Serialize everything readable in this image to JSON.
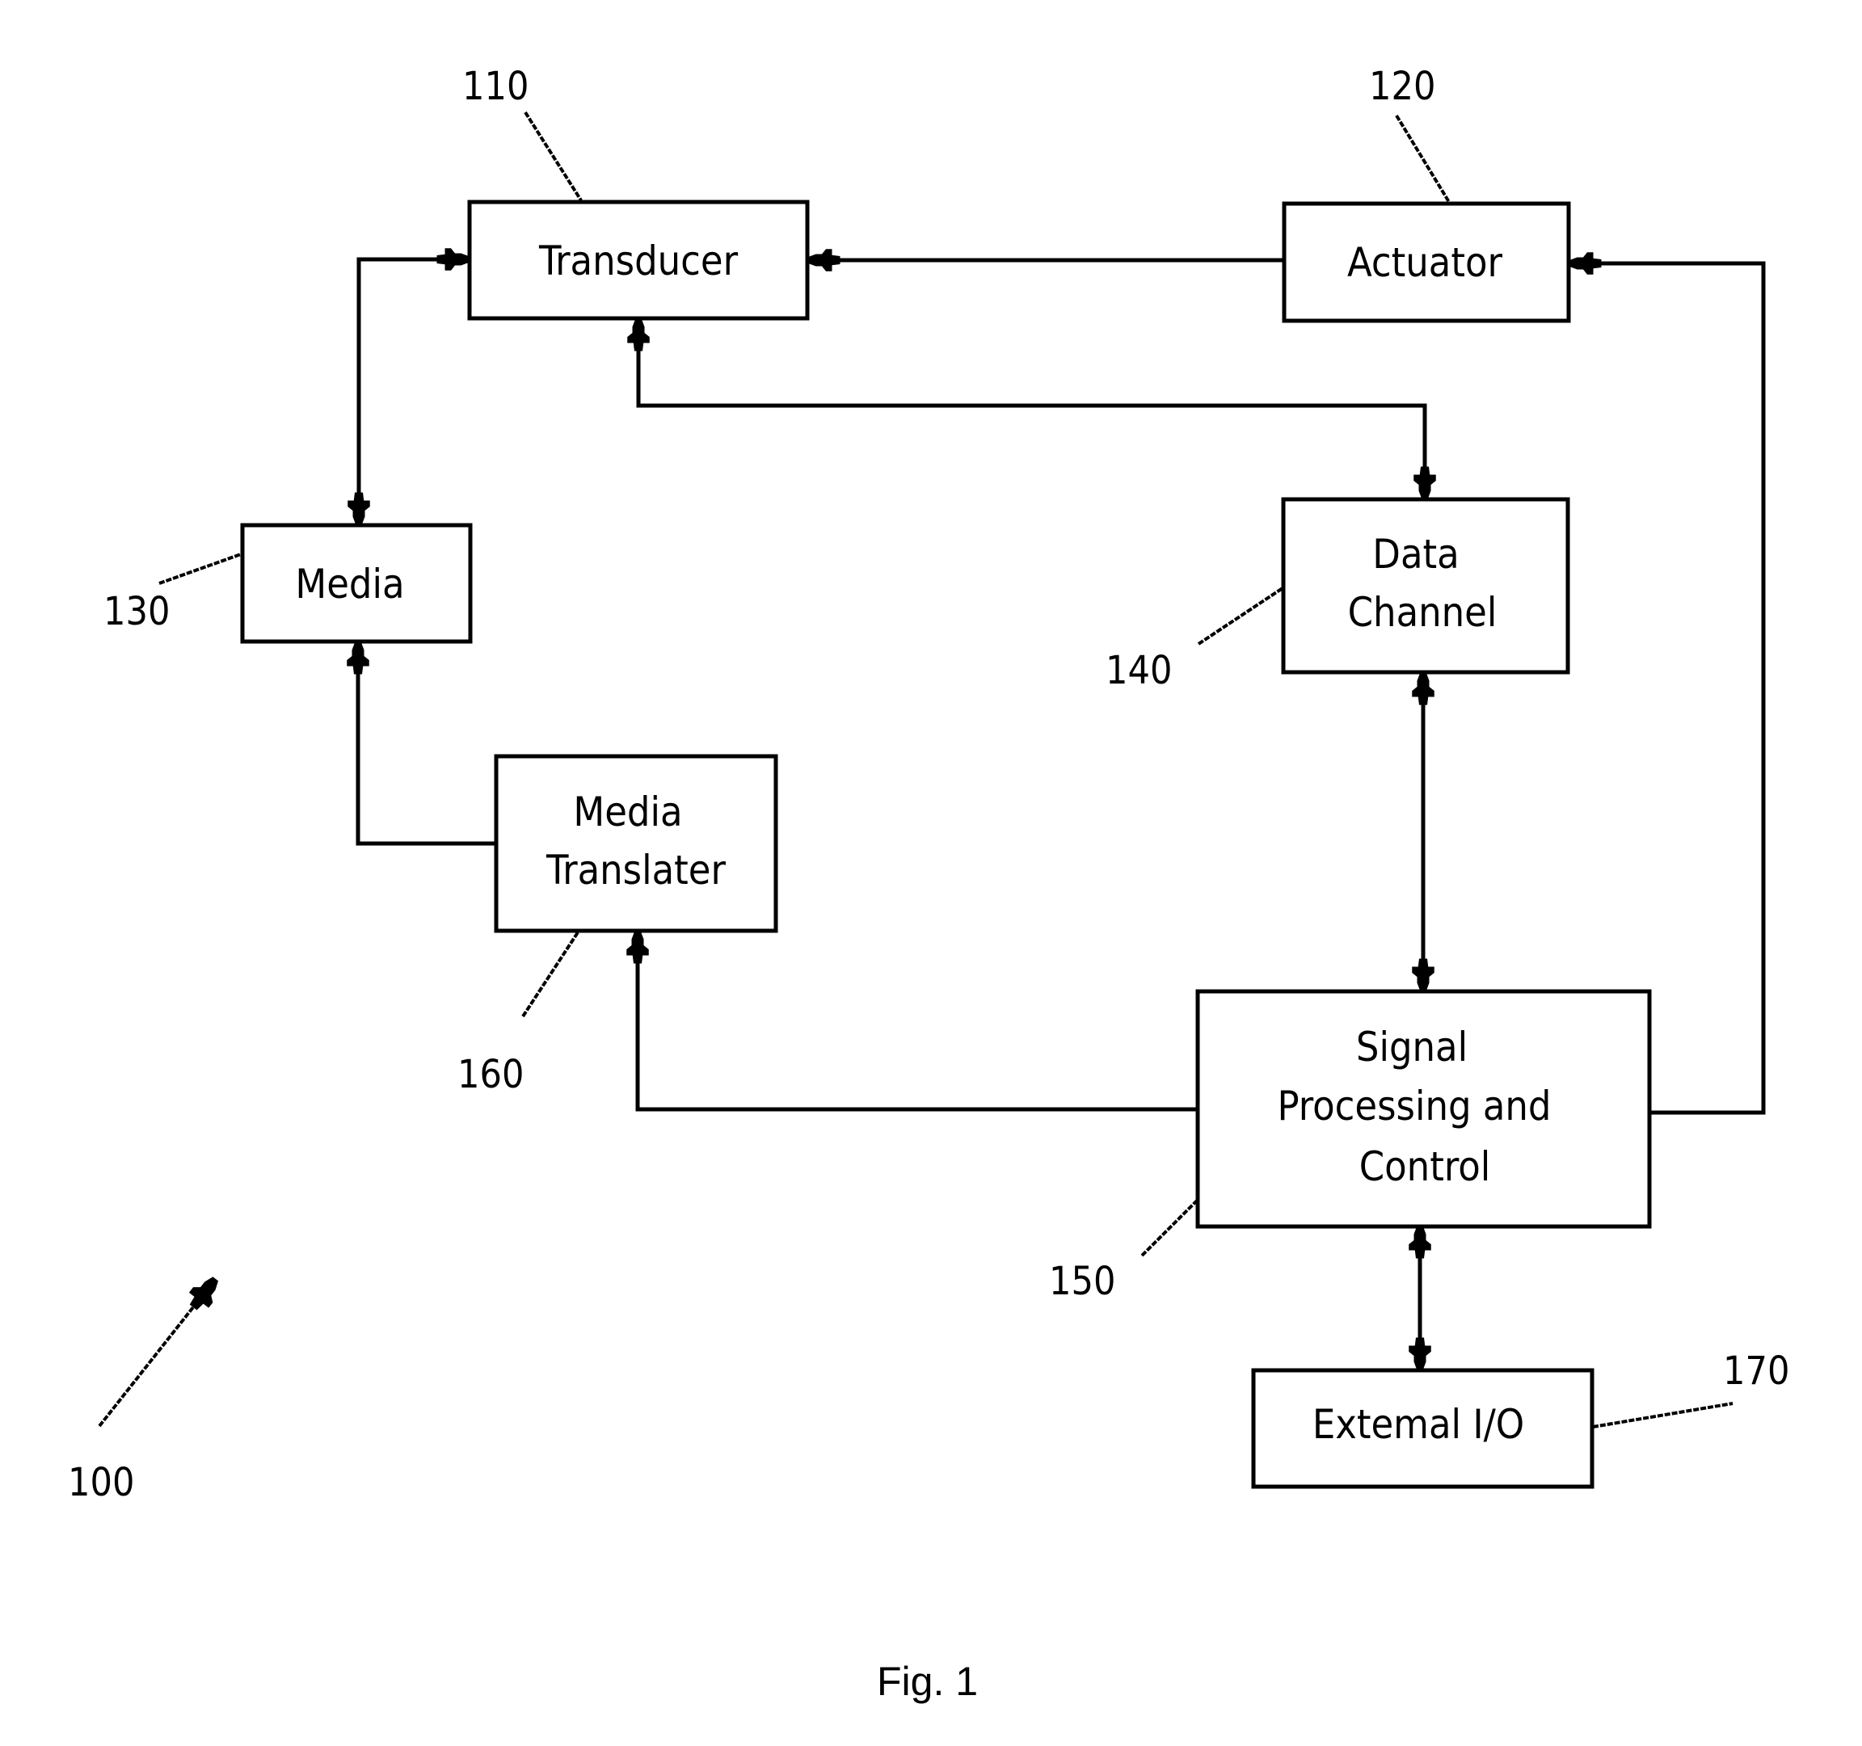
{
  "figure": {
    "caption": "Fig. 1",
    "system_ref": "100"
  },
  "blocks": {
    "transducer": {
      "ref": "110",
      "lines": [
        "Transducer"
      ]
    },
    "actuator": {
      "ref": "120",
      "lines": [
        "Actuator"
      ]
    },
    "media": {
      "ref": "130",
      "lines": [
        "Media"
      ]
    },
    "data_channel": {
      "ref": "140",
      "lines": [
        "Data",
        "Channel"
      ]
    },
    "signal_processing": {
      "ref": "150",
      "lines": [
        "Signal",
        "Processing and",
        "Control"
      ]
    },
    "media_translater": {
      "ref": "160",
      "lines": [
        "Media",
        "Translater"
      ]
    },
    "external_io": {
      "ref": "170",
      "lines": [
        "Extemal I/O"
      ]
    }
  },
  "connections": [
    {
      "from": "actuator",
      "to": "transducer",
      "direction": "one-way"
    },
    {
      "from": "signal_processing",
      "to": "actuator",
      "direction": "one-way"
    },
    {
      "from": "transducer",
      "to": "media",
      "direction": "two-way"
    },
    {
      "from": "transducer",
      "to": "data_channel",
      "direction": "two-way"
    },
    {
      "from": "media_translater",
      "to": "media",
      "direction": "one-way"
    },
    {
      "from": "data_channel",
      "to": "signal_processing",
      "direction": "two-way"
    },
    {
      "from": "signal_processing",
      "to": "media_translater",
      "direction": "one-way"
    },
    {
      "from": "signal_processing",
      "to": "external_io",
      "direction": "two-way"
    }
  ]
}
